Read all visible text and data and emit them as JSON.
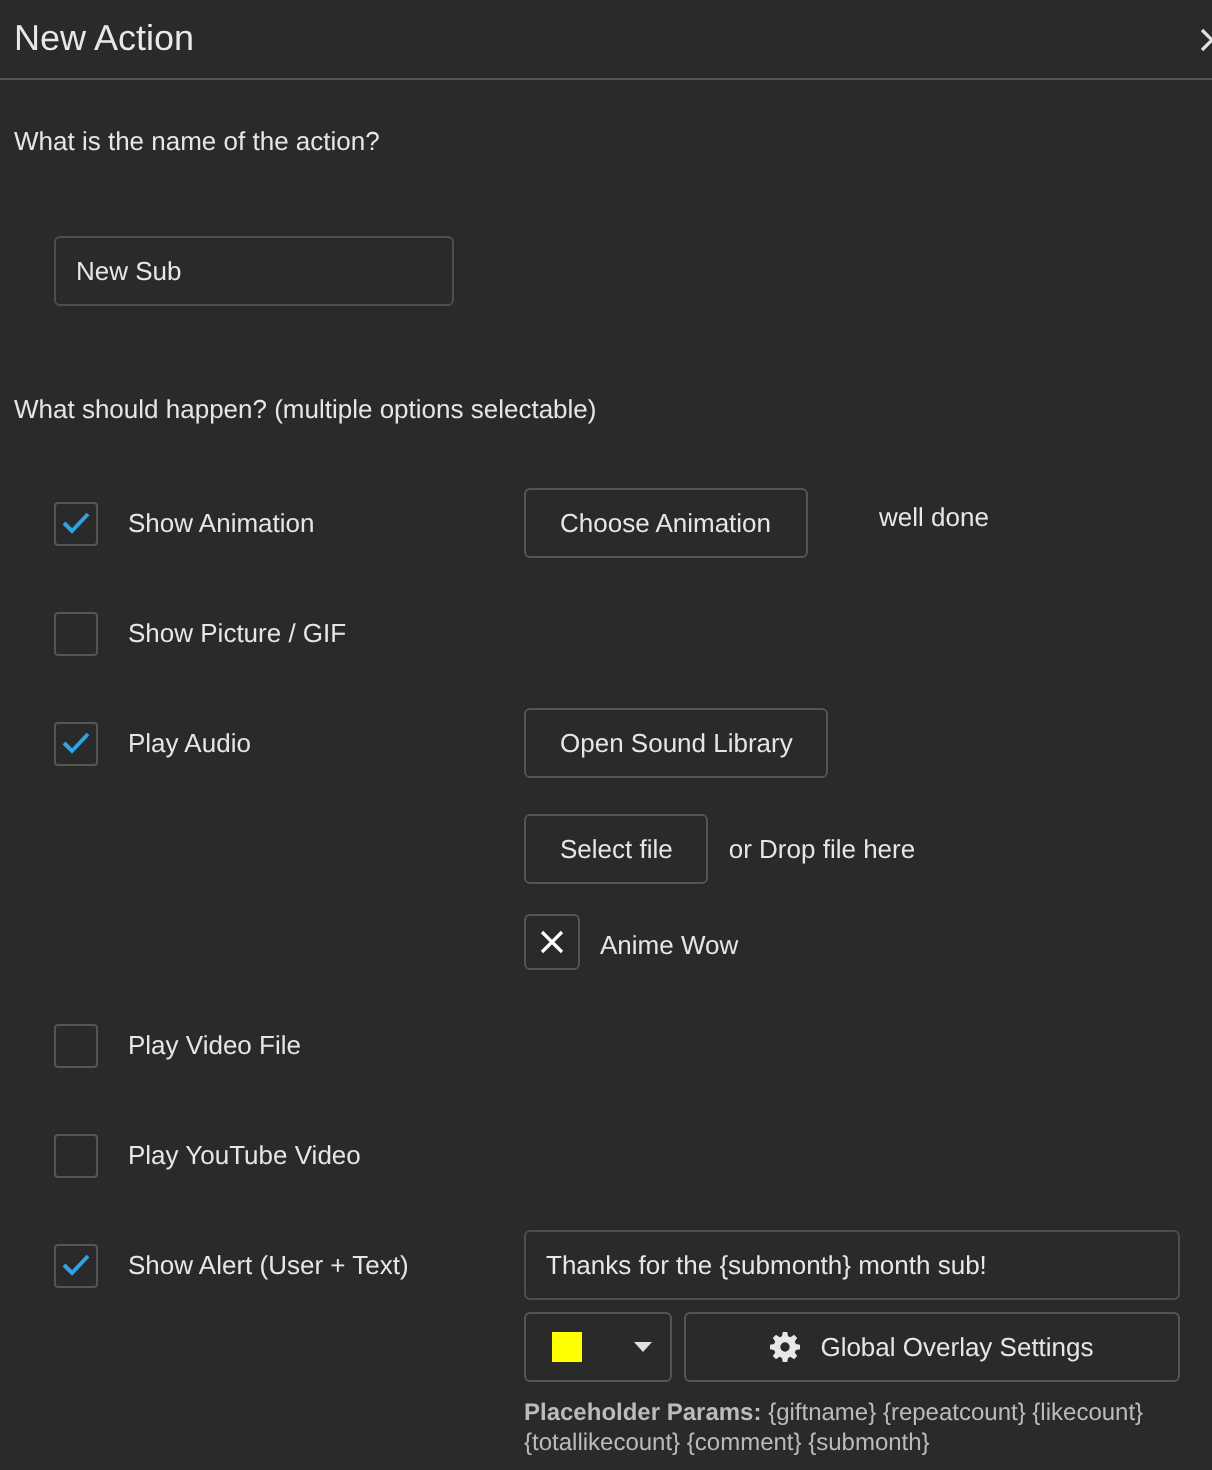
{
  "window": {
    "title": "New Action"
  },
  "name_question": "What is the name of the action?",
  "name_field": {
    "value": "New Sub"
  },
  "options_question": "What should happen? (multiple options selectable)",
  "options": [
    {
      "label": "Show Animation",
      "checked": true,
      "controls": [
        {
          "kind": "button_note",
          "button": "Choose Animation",
          "note": "well done"
        }
      ]
    },
    {
      "label": "Show Picture / GIF",
      "checked": false
    },
    {
      "label": "Play Audio",
      "checked": true,
      "controls": [
        {
          "kind": "button",
          "button": "Open Sound Library"
        },
        {
          "kind": "file_drop",
          "button": "Select file",
          "note": "or Drop file here"
        },
        {
          "kind": "removable_file",
          "name": "Anime Wow"
        }
      ]
    },
    {
      "label": "Play Video File",
      "checked": false
    },
    {
      "label": "Play YouTube Video",
      "checked": false
    },
    {
      "label": "Show Alert (User + Text)",
      "checked": true,
      "controls": [
        {
          "kind": "text_field",
          "value": "Thanks for the {submonth} month sub!"
        },
        {
          "kind": "color_settings",
          "color": "#ffff00",
          "button": "Global Overlay Settings"
        },
        {
          "kind": "hint",
          "text": "**Placeholder Params:** {giftname} {repeatcount} {likecount} {totallikecount} {comment} {submonth}"
        }
      ]
    }
  ]
}
